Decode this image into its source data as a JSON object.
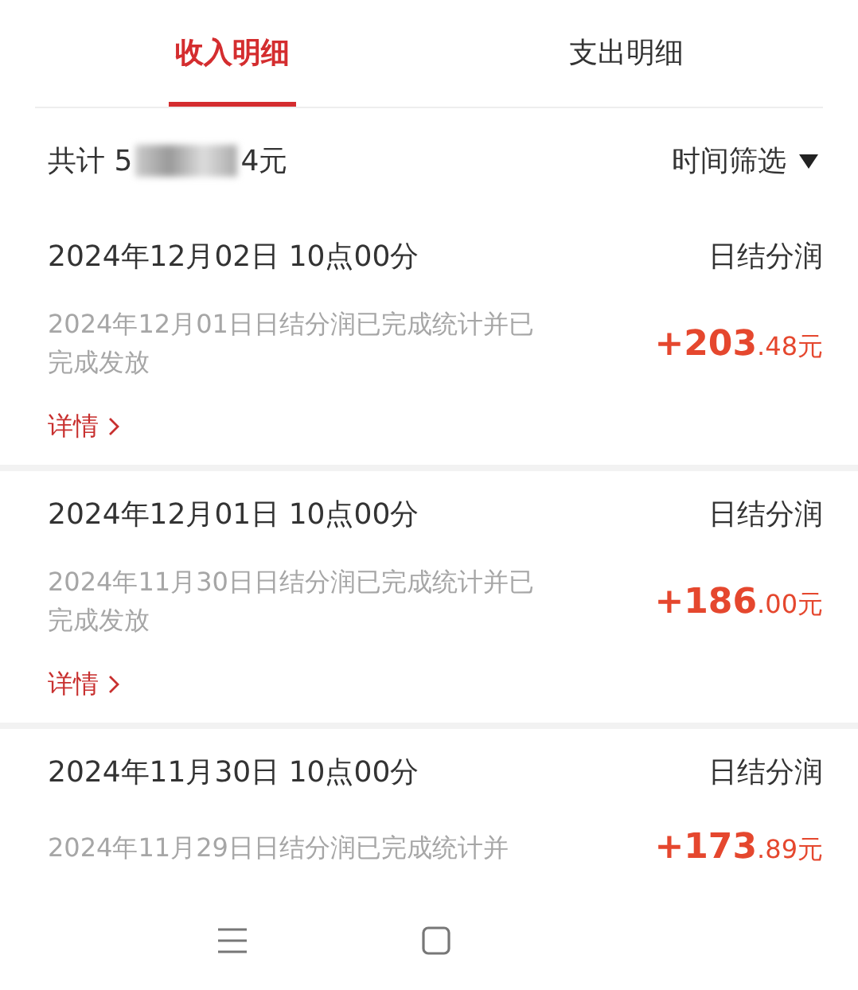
{
  "tabs": [
    {
      "label": "收入明细",
      "selected": true
    },
    {
      "label": "支出明细",
      "selected": false
    }
  ],
  "summary": {
    "prefix": "共计 5",
    "suffix": "4元",
    "filter_label": "时间筛选"
  },
  "records": [
    {
      "time": "2024年12月02日 10点00分",
      "type": "日结分润",
      "description": "2024年12月01日日结分润已完成统计并已完成发放",
      "amount_integer": "+203",
      "amount_decimal": ".48元",
      "detail_link": "详情"
    },
    {
      "time": "2024年12月01日 10点00分",
      "type": "日结分润",
      "description": "2024年11月30日日结分润已完成统计并已完成发放",
      "amount_integer": "+186",
      "amount_decimal": ".00元",
      "detail_link": "详情"
    },
    {
      "time": "2024年11月30日 10点00分",
      "type": "日结分润",
      "description": "2024年11月29日日结分润已完成统计并",
      "amount_integer": "+173",
      "amount_decimal": ".89元"
    }
  ]
}
